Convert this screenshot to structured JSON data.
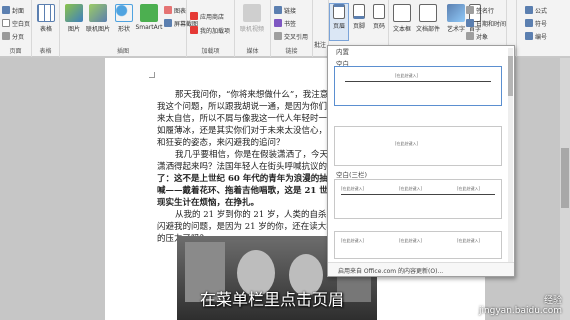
{
  "ribbon": {
    "pages_group": {
      "cover": "封面",
      "blank": "空白页",
      "page_break": "分页",
      "label": "页面"
    },
    "table_group": {
      "table": "表格",
      "label": "表格"
    },
    "illus_group": {
      "picture": "图片",
      "online_pic": "联机图片",
      "shapes": "形状",
      "smartart": "SmartArt",
      "chart": "图表",
      "screenshot": "屏幕截图",
      "label": "插图"
    },
    "addins_group": {
      "store": "应用商店",
      "myaddins": "我的加载项",
      "label": "加载项"
    },
    "media_group": {
      "video": "联机视频",
      "label": "媒体"
    },
    "links_group": {
      "link": "链接",
      "bookmark": "书签",
      "crossref": "交叉引用",
      "label": "链接"
    },
    "comments_group": {
      "comment": "批注",
      "label": "批注"
    },
    "header_group": {
      "header": "页眉",
      "footer": "页脚",
      "page_number": "页码",
      "label": "页眉"
    },
    "text_group": {
      "textbox": "文本框",
      "parts": "文档部件",
      "wordart": "艺术字",
      "dropcap": "首字",
      "signature": "签名行",
      "datetime": "日期和时间",
      "object": "对象"
    },
    "symbols_group": {
      "equation": "公式",
      "symbol": "符号",
      "number": "编号"
    }
  },
  "gallery": {
    "section_label": "内置",
    "items": [
      {
        "name": "空白",
        "ph": "[在此处键入]"
      },
      {
        "name": "空白(三栏)",
        "ph": "[在此处键入]"
      },
      {
        "name": "",
        "ph": "[在此处键入]"
      }
    ],
    "footer": "启用来自 Office.com 的内容更新(O)..."
  },
  "document": {
    "lines": [
      "那天我问你，“你将来想做什么”，我注意到",
      "我这个问题，所以跟我胡说一通，是因为你们对",
      "来太自信，所以不屑与像我这一代人年轻时一样",
      "如履薄冰，还是其实你们对于未来太没信心，",
      "和狂妄的姿态，来闪避我的追问？",
      "我几乎要相信，你是在假装潇洒了，今天白",
      "潇洒得起来吗？法国年轻人在街头呼喊抗议的",
      "了：这不是上世纪 60 年代的青年为浪漫的抽象",
      "喊——戴着花环、拖着吉他唱歌，这是 21 世纪",
      "现实生计在烦恼，在挣扎。",
      "从我的 21 岁到你的 21 岁，人类的自杀率",
      "闪避我的问题，是因为 21 岁的你，还在读大学",
      "的压力了吗？"
    ]
  },
  "caption": "在菜单栏里点击页眉",
  "watermark": {
    "site": "经验",
    "url": "jingyan.baidu.com"
  },
  "colors": {
    "ribbon_bg": "#f3f3f3",
    "selected_border": "#5b8fd0",
    "doc_bg": "#c6c6c6"
  }
}
